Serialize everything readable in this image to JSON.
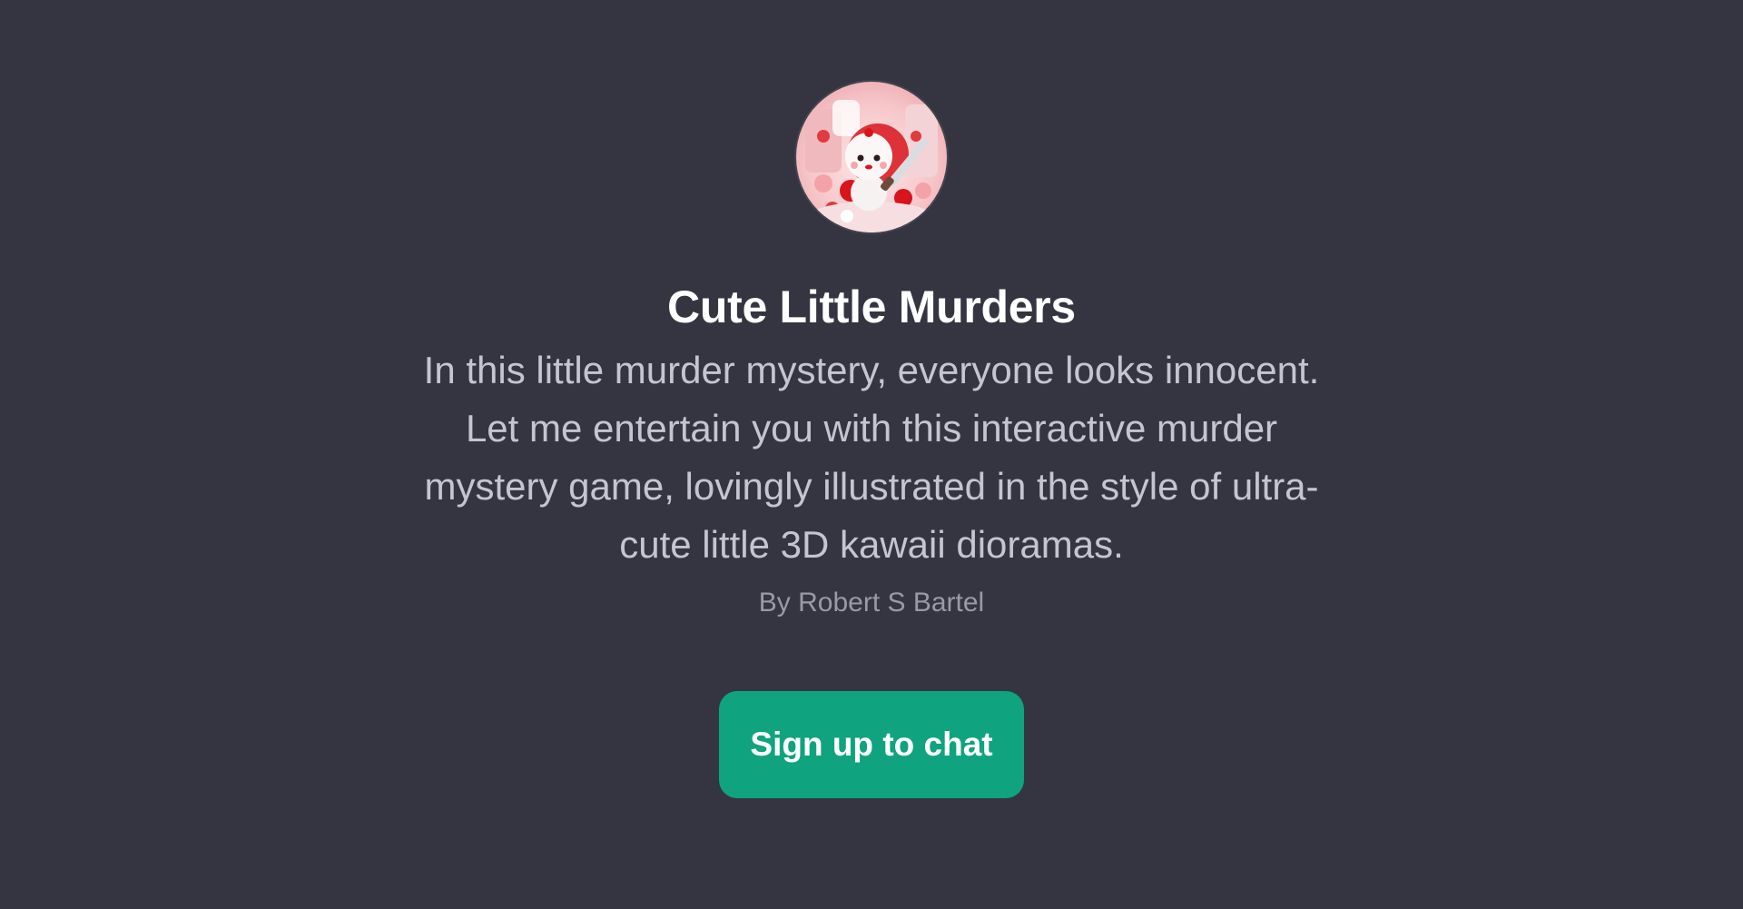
{
  "gpt": {
    "avatar_icon": "knife-wielding-kawaii-character-avatar",
    "title": "Cute Little Murders",
    "description": "In this little murder mystery, everyone looks innocent. Let me entertain you with this interactive murder mystery game, lovingly illustrated in the style of ultra-cute little 3D kawaii dioramas.",
    "author": "By Robert S Bartel"
  },
  "actions": {
    "signup_label": "Sign up to chat"
  },
  "colors": {
    "background": "#343541",
    "button": "#10a37f",
    "title": "#ffffff",
    "description": "#c5c5d2",
    "author": "#9a9aa6"
  }
}
